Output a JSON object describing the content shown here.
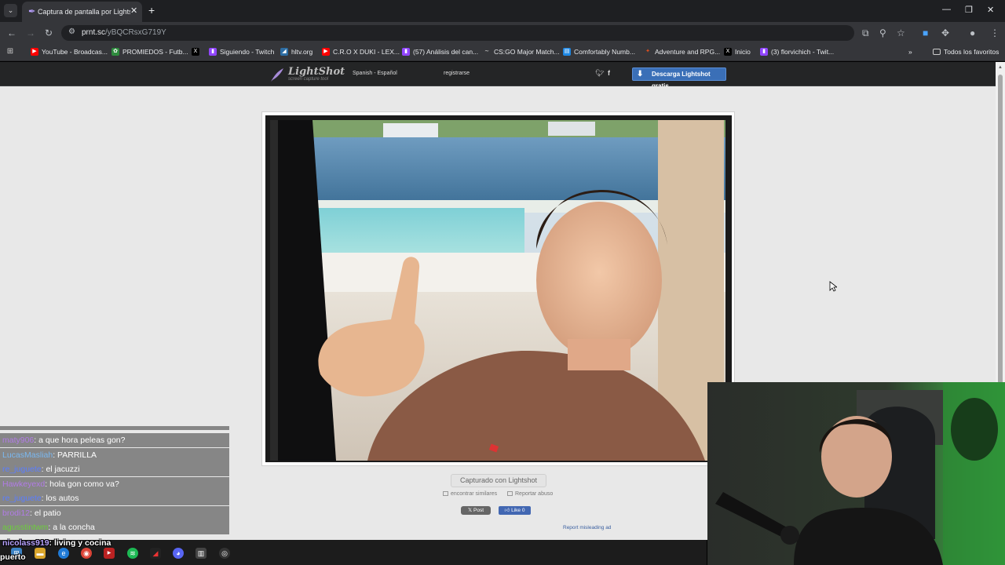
{
  "browser": {
    "tab_title": "Captura de pantalla por Lightsh",
    "url_host": "prnt.sc",
    "url_path": "/yBQCRsxG719Y",
    "bookmarks": [
      {
        "label": "YouTube - Broadcas...",
        "icon": "youtube-icon",
        "color": "#ff0000"
      },
      {
        "label": "PROMIEDOS - Futb...",
        "icon": "promiedos-icon",
        "color": "#2e8b3e"
      },
      {
        "label": "",
        "icon": "x-icon",
        "color": "#000000"
      },
      {
        "label": "Siguiendo - Twitch",
        "icon": "twitch-icon",
        "color": "#9146ff"
      },
      {
        "label": "hltv.org",
        "icon": "hltv-icon",
        "color": "#2d6da3"
      },
      {
        "label": "C.R.O X DUKI - LEX...",
        "icon": "youtube-icon",
        "color": "#ff0000"
      },
      {
        "label": "(57) Análisis del can...",
        "icon": "twitch-icon",
        "color": "#9146ff"
      },
      {
        "label": "CS:GO Major Match...",
        "icon": "liquipedia-icon",
        "color": "#3a3a3a"
      },
      {
        "label": "Comfortably Numb...",
        "icon": "doc-icon",
        "color": "#1e88e5"
      },
      {
        "label": "Adventure and RPG...",
        "icon": "game-icon",
        "color": "#e0501f"
      },
      {
        "label": "Inicio",
        "icon": "x-icon",
        "color": "#000000"
      },
      {
        "label": "(3) florvichich - Twit...",
        "icon": "twitch-icon",
        "color": "#9146ff"
      }
    ],
    "all_bookmarks": "Todos los favoritos"
  },
  "lightshot": {
    "logo": "LightShot",
    "logo_sub": "screen capture tool",
    "language": "Spanish - Español",
    "register": "registrarse",
    "download": "Descarga Lightshot gratis",
    "captured": "Capturado con Lightshot",
    "find_similar": "encontrar similares",
    "report_abuse": "Reportar abuso",
    "post": "Post",
    "like": "Like 0",
    "report_ad": "Report misleading ad"
  },
  "chat": {
    "messages": [
      {
        "user": "maty906",
        "user_color": "#b17be6",
        "text": ": a que hora peleas gon?"
      },
      {
        "user": "LucasMasliah",
        "user_color": "#7ab8f0",
        "text": ": PARRILLA"
      },
      {
        "user": "re_juguete",
        "user_color": "#5a7dff",
        "text": ": el jacuzzi"
      },
      {
        "user": "Hawkeyexd",
        "user_color": "#b17be6",
        "text": ": hola gon como va?"
      },
      {
        "user": "re_juguete",
        "user_color": "#5a7dff",
        "text": ": los autos"
      },
      {
        "user": "brodi12",
        "user_color": "#b17be6",
        "text": ": el patio"
      },
      {
        "user": "agusstintwm",
        "user_color": "#6ccf3a",
        "text": ": a la concha"
      },
      {
        "user": "nicolass919",
        "user_color": "#b8a3ff",
        "text": ": living y cocina"
      }
    ],
    "partial_bottom": "puerto"
  }
}
